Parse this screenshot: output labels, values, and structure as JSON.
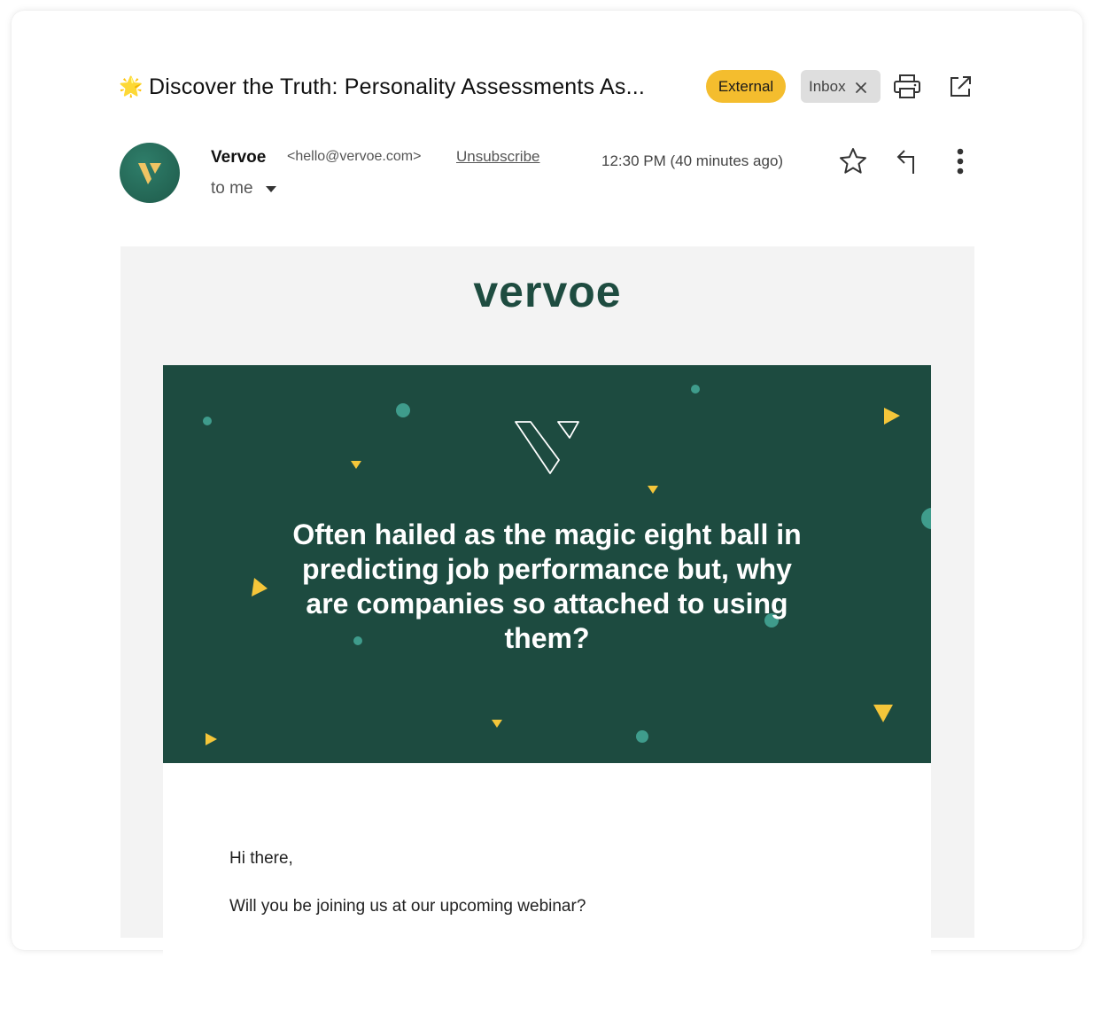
{
  "email": {
    "subject_emoji": "🌟",
    "subject": "Discover the Truth: Personality Assessments As...",
    "labels": {
      "external": "External",
      "inbox": "Inbox"
    },
    "toolbar_icons": [
      "print-icon",
      "open-in-new-window-icon"
    ],
    "sender": {
      "name": "Vervoe",
      "email": "<hello@vervoe.com>",
      "unsubscribe": "Unsubscribe",
      "recipient": "to me",
      "timestamp": "12:30 PM (40 minutes ago)"
    },
    "action_icons": [
      "star-icon",
      "reply-icon",
      "more-vert-icon"
    ]
  },
  "newsletter": {
    "logo": "vervoe",
    "headline": "Often hailed as the magic eight ball in predicting job performance but, why are companies so attached to using them?",
    "greeting": "Hi there,",
    "paragraph_1": "Will you be joining us at our upcoming webinar?"
  },
  "colors": {
    "brand_green": "#1d4b40",
    "accent_yellow": "#f4bd2e",
    "dot_teal": "#3f9c8c",
    "external_badge": "#f4bd2e",
    "inbox_badge": "#dedede"
  }
}
